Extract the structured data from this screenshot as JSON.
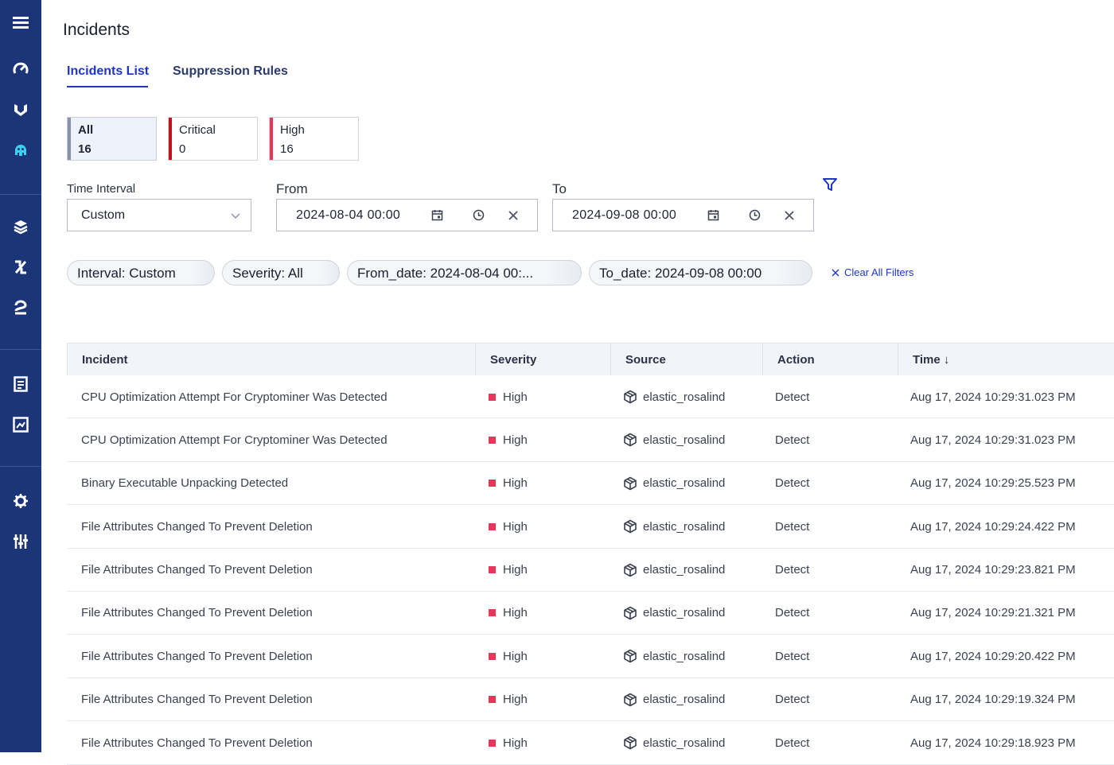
{
  "page": {
    "title": "Incidents"
  },
  "tabs": [
    {
      "label": "Incidents List",
      "active": true
    },
    {
      "label": "Suppression Rules",
      "active": false
    }
  ],
  "severity_cards": [
    {
      "label": "All",
      "count": "16",
      "color": "#8a93a6",
      "selected": true
    },
    {
      "label": "Critical",
      "count": "0",
      "color": "#c1121f",
      "selected": false
    },
    {
      "label": "High",
      "count": "16",
      "color": "#e8365a",
      "selected": false
    }
  ],
  "filters": {
    "time_interval_label": "Time Interval",
    "time_interval_value": "Custom",
    "from_label": "From",
    "from_value": "2024-08-04 00:00",
    "to_label": "To",
    "to_value": "2024-09-08 00:00"
  },
  "chips": [
    "Interval: Custom",
    "Severity: All",
    "From_date: 2024-08-04 00:...",
    "To_date: 2024-09-08 00:00"
  ],
  "clear_all_label": "Clear All Filters",
  "table": {
    "columns": [
      "Incident",
      "Severity",
      "Source",
      "Action",
      "Time"
    ],
    "sort_indicator": "↓",
    "rows": [
      {
        "incident": "CPU Optimization Attempt For Cryptominer Was Detected",
        "severity": "High",
        "source": "elastic_rosalind",
        "action": "Detect",
        "time": "Aug 17, 2024 10:29:31.023 PM"
      },
      {
        "incident": "CPU Optimization Attempt For Cryptominer Was Detected",
        "severity": "High",
        "source": "elastic_rosalind",
        "action": "Detect",
        "time": "Aug 17, 2024 10:29:31.023 PM"
      },
      {
        "incident": "Binary Executable Unpacking Detected",
        "severity": "High",
        "source": "elastic_rosalind",
        "action": "Detect",
        "time": "Aug 17, 2024 10:29:25.523 PM"
      },
      {
        "incident": "File Attributes Changed To Prevent Deletion",
        "severity": "High",
        "source": "elastic_rosalind",
        "action": "Detect",
        "time": "Aug 17, 2024 10:29:24.422 PM"
      },
      {
        "incident": "File Attributes Changed To Prevent Deletion",
        "severity": "High",
        "source": "elastic_rosalind",
        "action": "Detect",
        "time": "Aug 17, 2024 10:29:23.821 PM"
      },
      {
        "incident": "File Attributes Changed To Prevent Deletion",
        "severity": "High",
        "source": "elastic_rosalind",
        "action": "Detect",
        "time": "Aug 17, 2024 10:29:21.321 PM"
      },
      {
        "incident": "File Attributes Changed To Prevent Deletion",
        "severity": "High",
        "source": "elastic_rosalind",
        "action": "Detect",
        "time": "Aug 17, 2024 10:29:20.422 PM"
      },
      {
        "incident": "File Attributes Changed To Prevent Deletion",
        "severity": "High",
        "source": "elastic_rosalind",
        "action": "Detect",
        "time": "Aug 17, 2024 10:29:19.324 PM"
      },
      {
        "incident": "File Attributes Changed To Prevent Deletion",
        "severity": "High",
        "source": "elastic_rosalind",
        "action": "Detect",
        "time": "Aug 17, 2024 10:29:18.923 PM"
      }
    ]
  },
  "colors": {
    "sidebar": "#1c3578",
    "accent": "#1d36c9",
    "active_icon": "#3ad0f0",
    "high": "#e8365a",
    "critical": "#c1121f"
  },
  "sidebar_icons": [
    "menu-icon",
    "dashboard-gauge-icon",
    "shield-icon",
    "incidents-octopus-icon",
    "layers-icon",
    "percent-icon",
    "integration-icon",
    "reports-document-icon",
    "analytics-icon",
    "settings-gear-icon",
    "sliders-icon"
  ]
}
